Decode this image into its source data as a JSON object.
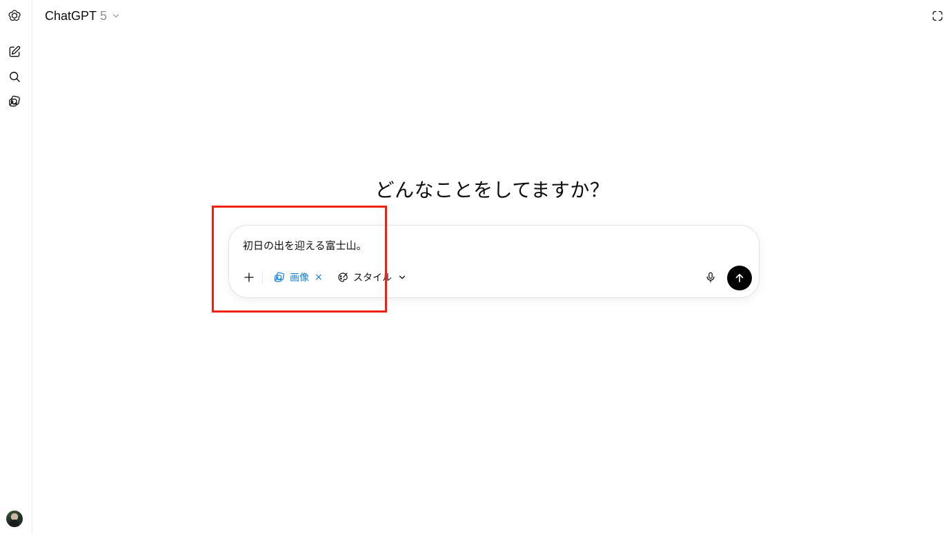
{
  "header": {
    "model_name": "ChatGPT",
    "model_version": "5",
    "model_menu_icon": "chevron-down-icon",
    "temporary_chat_icon": "dashed-circle-icon"
  },
  "sidebar": {
    "items": [
      {
        "name": "openai-logo",
        "icon": "openai-logo-icon"
      },
      {
        "name": "new-chat",
        "icon": "new-chat-icon"
      },
      {
        "name": "search-chats",
        "icon": "search-icon"
      },
      {
        "name": "library",
        "icon": "images-icon"
      }
    ],
    "avatar": "user-avatar"
  },
  "main": {
    "headline": "どんなことをしてますか？"
  },
  "composer": {
    "text": "初日の出を迎える富士山。",
    "image_tool_label": "画像",
    "image_tool_remove": "×",
    "style_label": "スタイル",
    "accent_color": "#0f7fd6",
    "send_button_color": "#000000"
  },
  "annotation": {
    "highlight_color": "#f21f0f"
  }
}
